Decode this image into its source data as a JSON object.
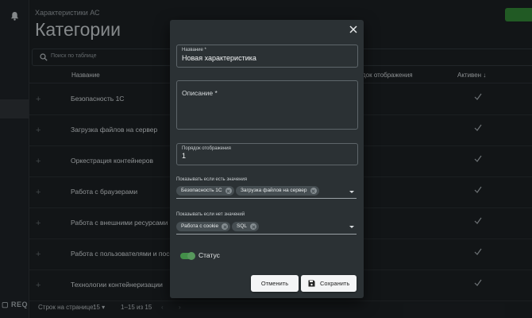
{
  "app": {
    "breadcrumb": "Характеристики АС",
    "title": "Категории",
    "logo_text": "REQ"
  },
  "search": {
    "placeholder": "Поиск по таблице"
  },
  "table": {
    "columns": {
      "name": "Название",
      "order": "док отображения",
      "active": "Активен ↓"
    },
    "rows": [
      {
        "name": "Безопасность 1С",
        "active": true
      },
      {
        "name": "Загрузка файлов на сервер",
        "active": true
      },
      {
        "name": "Оркестрация контейнеров",
        "active": true
      },
      {
        "name": "Работа с браузерами",
        "active": true
      },
      {
        "name": "Работа с внешними ресурсами и",
        "active": true
      },
      {
        "name": "Работа с пользователями и посе",
        "active": true
      },
      {
        "name": "Технологии контейнеризации",
        "active": true
      }
    ]
  },
  "footer": {
    "rows_per_page_label": "Строк на странице:",
    "rows_per_page": "15",
    "range": "1–15 из 15"
  },
  "modal": {
    "name_label": "Название *",
    "name_value": "Новая характеристика",
    "description_label": "Описание *",
    "order_label": "Порядок отображения",
    "order_value": "1",
    "show_if_has_label": "Показывать если есть значения",
    "show_if_has_chips": [
      "Безопасность 1С",
      "Загрузка файлов на сервер"
    ],
    "show_if_not_label": "Показывать если нет значений",
    "show_if_not_chips": [
      "Работа с cookie",
      "SQL"
    ],
    "status_label": "Статус",
    "status_on": true,
    "cancel_label": "Отменить",
    "save_label": "Сохранить"
  },
  "colors": {
    "accent": "#4caf50",
    "background": "#1a1e21",
    "modal": "#2b3134"
  }
}
